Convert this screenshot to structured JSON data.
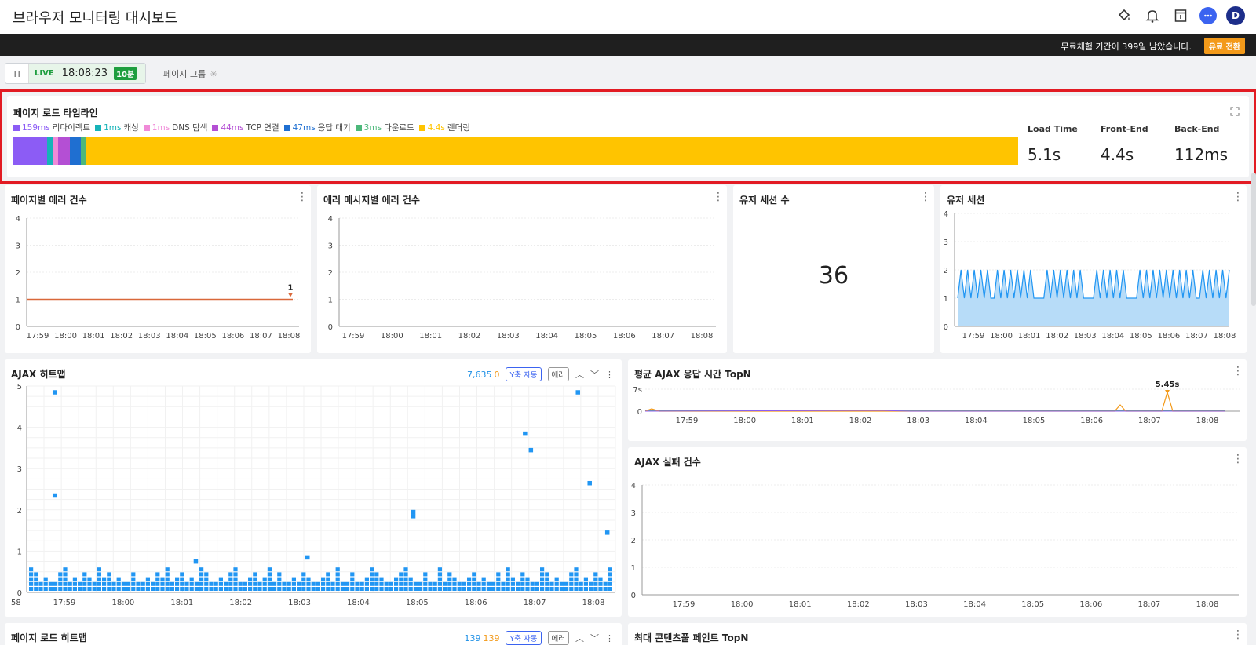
{
  "header": {
    "title": "브라우저 모니터링 대시보드",
    "avatar_letter": "D",
    "icons": [
      "paint-bucket-icon",
      "bell-icon",
      "calendar-icon",
      "chat-icon"
    ]
  },
  "trial": {
    "message": "무료체험 기간이 399일 남았습니다.",
    "button": "유료 전환"
  },
  "live": {
    "label": "LIVE",
    "time": "18:08:23",
    "interval": "10분"
  },
  "page_group": {
    "label": "페이지 그룹"
  },
  "timeline": {
    "title": "페이지 로드 타임라인",
    "legend": [
      {
        "value": "159ms",
        "label": "리다이렉트",
        "color": "#8c5cf5"
      },
      {
        "value": "1ms",
        "label": "캐싱",
        "color": "#17b3b8"
      },
      {
        "value": "1ms",
        "label": "DNS 탐색",
        "color": "#f08ad8"
      },
      {
        "value": "44ms",
        "label": "TCP 연결",
        "color": "#b44fd4"
      },
      {
        "value": "47ms",
        "label": "응답 대기",
        "color": "#1f6fd1"
      },
      {
        "value": "3ms",
        "label": "다운로드",
        "color": "#4cb87a"
      },
      {
        "value": "4.4s",
        "label": "렌더링",
        "color": "#ffc400"
      }
    ],
    "metrics": [
      {
        "label": "Load Time",
        "value": "5.1s"
      },
      {
        "label": "Front-End",
        "value": "4.4s"
      },
      {
        "label": "Back-End",
        "value": "112ms"
      }
    ]
  },
  "cards": {
    "errors_by_page": {
      "title": "페이지별 에러 건수",
      "annotation": "1"
    },
    "errors_by_message": {
      "title": "에러 메시지별 에러 건수"
    },
    "user_sessions_count": {
      "title": "유저 세션 수",
      "value": "36"
    },
    "user_sessions": {
      "title": "유저 세션"
    },
    "ajax_heatmap": {
      "title": "AJAX 히트맵",
      "count_total": "7,635",
      "count_error": "0",
      "yaxis": "Y축 자동",
      "error_btn": "에러"
    },
    "ajax_avg_topn": {
      "title": "평균 AJAX 응답 시간 TopN",
      "peak_label": "5.45s"
    },
    "ajax_fail": {
      "title": "AJAX 실패 건수"
    },
    "pageload_heatmap": {
      "title": "페이지 로드 히트맵",
      "count_total": "139",
      "count_error": "139",
      "yaxis": "Y축 자동",
      "error_btn": "에러"
    },
    "max_contentful_paint": {
      "title": "최대 콘텐츠풀 페인트 TopN"
    }
  },
  "chart_data": [
    {
      "type": "line",
      "title": "페이지별 에러 건수",
      "x": [
        "17:59",
        "18:00",
        "18:01",
        "18:02",
        "18:03",
        "18:04",
        "18:05",
        "18:06",
        "18:07",
        "18:08"
      ],
      "y_ticks": [
        "0",
        "1",
        "2",
        "3",
        "4"
      ],
      "ylim": [
        0,
        4
      ],
      "series": [
        {
          "values": [
            1,
            1,
            1,
            1,
            1,
            1,
            1,
            1,
            1,
            1
          ],
          "color": "#d9683a"
        }
      ]
    },
    {
      "type": "line",
      "title": "에러 메시지별 에러 건수",
      "x": [
        "17:59",
        "18:00",
        "18:01",
        "18:02",
        "18:03",
        "18:04",
        "18:05",
        "18:06",
        "18:07",
        "18:08"
      ],
      "y_ticks": [
        "0",
        "1",
        "2",
        "3",
        "4"
      ],
      "ylim": [
        0,
        4
      ],
      "series": []
    },
    {
      "type": "area",
      "title": "유저 세션",
      "x": [
        "17:59",
        "18:00",
        "18:01",
        "18:02",
        "18:03",
        "18:04",
        "18:05",
        "18:06",
        "18:07",
        "18:08"
      ],
      "y_ticks": [
        "0",
        "1",
        "2",
        "3",
        "4"
      ],
      "ylim": [
        0,
        4
      ],
      "series": [
        {
          "values": [
            1,
            2,
            1,
            2,
            1,
            2,
            1,
            2,
            1,
            2,
            1,
            1,
            2,
            1,
            2,
            1,
            2,
            1,
            2,
            1,
            2,
            1,
            2,
            1,
            1,
            1,
            1,
            2,
            1,
            2,
            1,
            2,
            1,
            2,
            1,
            2,
            1,
            2,
            1,
            1,
            1,
            1,
            2,
            1,
            2,
            1,
            2,
            1,
            2,
            1,
            2,
            1,
            1,
            1,
            1,
            2,
            1,
            2,
            1,
            2,
            1,
            2,
            1,
            2,
            1,
            2,
            1,
            2,
            1,
            2,
            1,
            2,
            1,
            1,
            2,
            1,
            2,
            1,
            2,
            1,
            2,
            1,
            2
          ],
          "color": "#2196f3"
        }
      ]
    },
    {
      "type": "scatter",
      "title": "AJAX 히트맵",
      "x": [
        "17:59",
        "18:00",
        "18:01",
        "18:02",
        "18:03",
        "18:04",
        "18:05",
        "18:06",
        "18:07",
        "18:08"
      ],
      "y_ticks": [
        "0",
        "1",
        "2",
        "3",
        "4",
        "5"
      ],
      "ylim": [
        0,
        5
      ],
      "outliers": [
        [
          0.2,
          4.9
        ],
        [
          0.2,
          2.4
        ],
        [
          6.3,
          2.0
        ],
        [
          6.3,
          1.9
        ],
        [
          8.2,
          3.9
        ],
        [
          8.3,
          3.5
        ],
        [
          9.1,
          4.9
        ],
        [
          9.3,
          2.7
        ],
        [
          9.6,
          1.5
        ],
        [
          9.9,
          1.6
        ],
        [
          4.5,
          0.9
        ],
        [
          2.6,
          0.8
        ]
      ]
    },
    {
      "type": "line",
      "title": "평균 AJAX 응답 시간 TopN",
      "x": [
        "17:59",
        "18:00",
        "18:01",
        "18:02",
        "18:03",
        "18:04",
        "18:05",
        "18:06",
        "18:07",
        "18:08"
      ],
      "y_ticks": [
        "0",
        "7s"
      ],
      "peak": {
        "x": "18:07",
        "value": "5.45s"
      }
    },
    {
      "type": "line",
      "title": "AJAX 실패 건수",
      "x": [
        "17:59",
        "18:00",
        "18:01",
        "18:02",
        "18:03",
        "18:04",
        "18:05",
        "18:06",
        "18:07",
        "18:08"
      ],
      "y_ticks": [
        "0",
        "1",
        "2",
        "3",
        "4"
      ],
      "ylim": [
        0,
        4
      ],
      "series": []
    }
  ]
}
